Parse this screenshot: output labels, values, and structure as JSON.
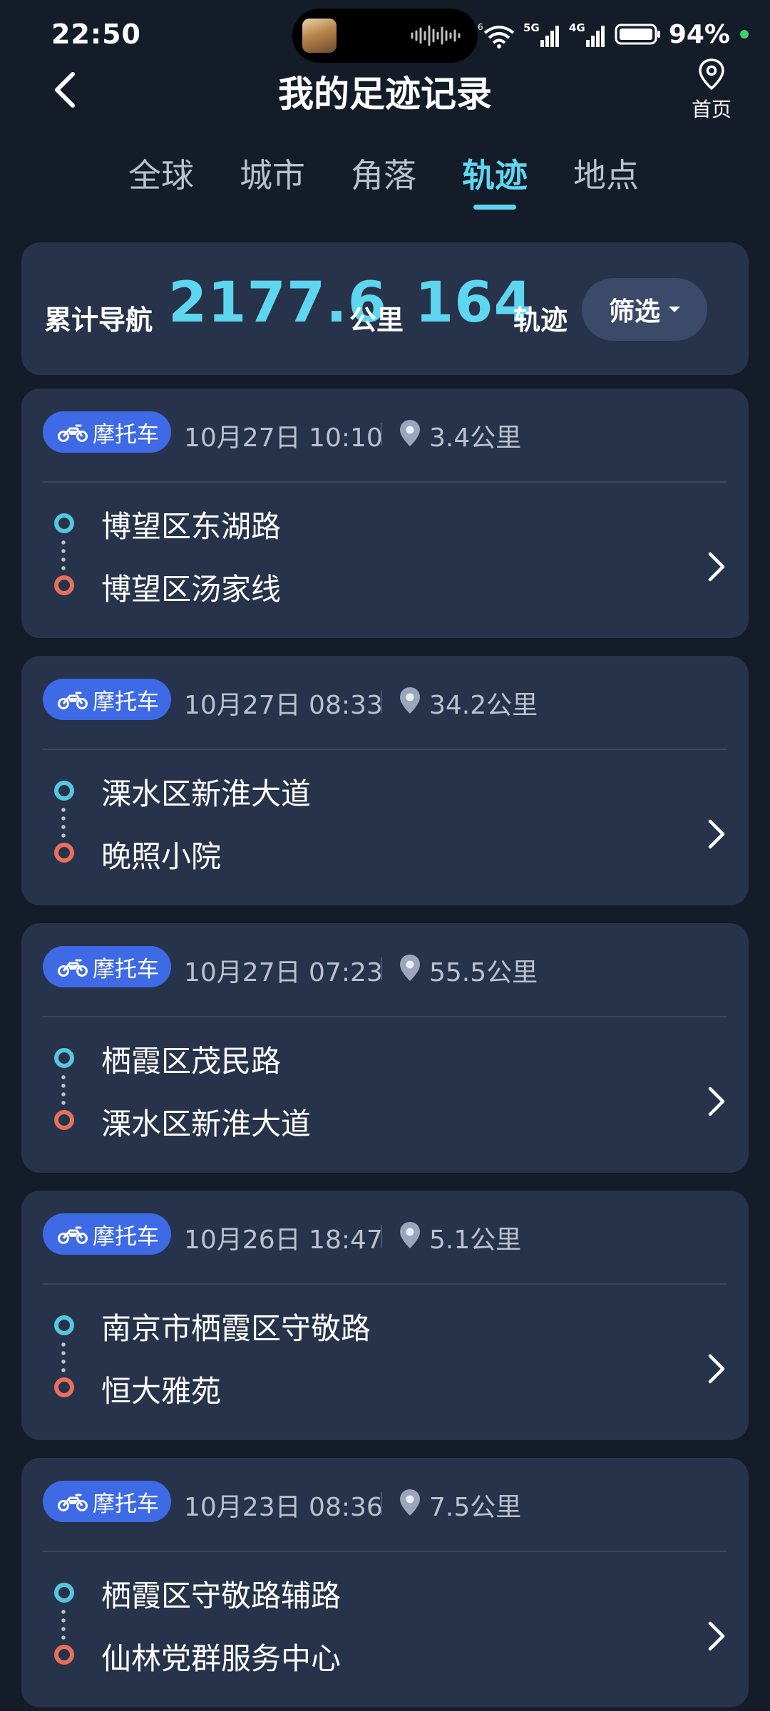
{
  "status_bar": {
    "time": "22:50",
    "battery_pct": "94%",
    "icons": [
      "wifi-icon",
      "signal-5g-icon",
      "signal-4g-icon",
      "battery-icon"
    ]
  },
  "header": {
    "title": "我的足迹记录",
    "home_label": "首页"
  },
  "tabs": [
    {
      "label": "全球"
    },
    {
      "label": "城市"
    },
    {
      "label": "角落"
    },
    {
      "label": "轨迹"
    },
    {
      "label": "地点"
    }
  ],
  "summary": {
    "label1": "累计导航",
    "distance": "2177.6",
    "unit1": "公里",
    "tracks": "164",
    "unit2": "轨迹",
    "filter_label": "筛选"
  },
  "trips": [
    {
      "mode": "摩托车",
      "time": "10月27日 10:10",
      "distance": "3.4公里",
      "start": "博望区东湖路",
      "end": "博望区汤家线"
    },
    {
      "mode": "摩托车",
      "time": "10月27日 08:33",
      "distance": "34.2公里",
      "start": "溧水区新淮大道",
      "end": "晚照小院"
    },
    {
      "mode": "摩托车",
      "time": "10月27日 07:23",
      "distance": "55.5公里",
      "start": "栖霞区茂民路",
      "end": "溧水区新淮大道"
    },
    {
      "mode": "摩托车",
      "time": "10月26日 18:47",
      "distance": "5.1公里",
      "start": "南京市栖霞区守敬路",
      "end": "恒大雅苑"
    },
    {
      "mode": "摩托车",
      "time": "10月23日 08:36",
      "distance": "7.5公里",
      "start": "栖霞区守敬路辅路",
      "end": "仙林党群服务中心"
    }
  ],
  "colors": {
    "background": "#141b29",
    "card": "#27334a",
    "accent": "#5fd6ef",
    "badge": "#3e6ae6",
    "start": "#57c6dd",
    "end": "#e6705c"
  }
}
